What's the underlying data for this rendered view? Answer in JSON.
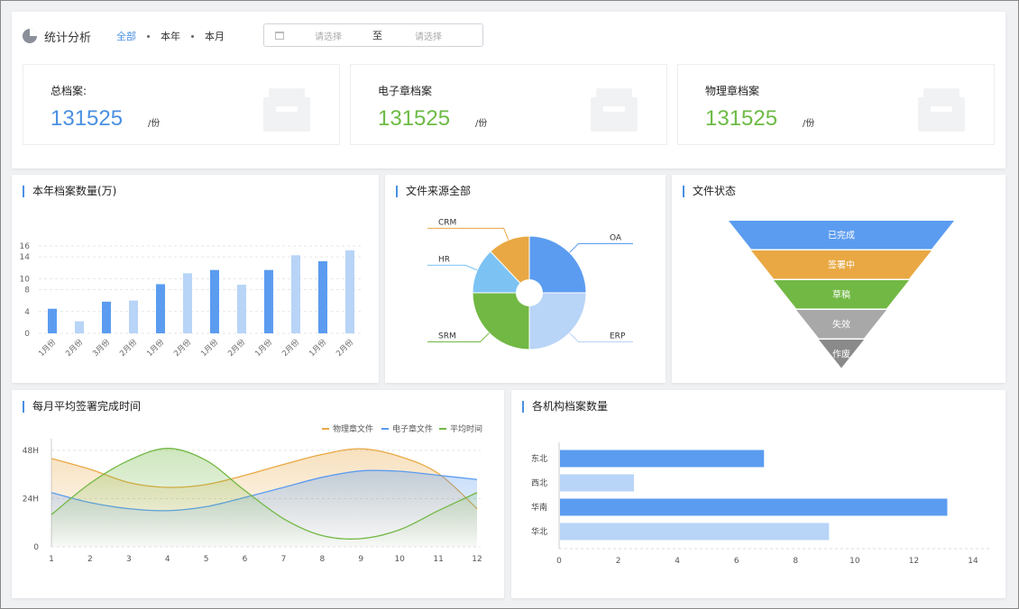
{
  "header": {
    "title": "统计分析",
    "filters": [
      "全部",
      "本年",
      "本月"
    ],
    "active_filter": "全部",
    "date_start_placeholder": "请选择",
    "date_separator": "至",
    "date_end_placeholder": "请选择"
  },
  "stats": [
    {
      "label": "总档案:",
      "value": "131525",
      "unit": "/份",
      "color": "#4a90e2"
    },
    {
      "label": "电子章档案",
      "value": "131525",
      "unit": "/份",
      "color": "#6dbb45"
    },
    {
      "label": "物理章档案",
      "value": "131525",
      "unit": "/份",
      "color": "#6dbb45"
    }
  ],
  "colors": {
    "blue": "#5b9cf0",
    "light_blue": "#b8d4f7",
    "orange": "#e9a843",
    "green": "#72b844",
    "sky": "#7cc3f4",
    "gray": "#a8a8a8",
    "dark_gray": "#8a8a8a"
  },
  "chart_data": [
    {
      "id": "bar",
      "type": "bar",
      "title": "本年档案数量(万)",
      "categories": [
        "1月份",
        "2月份",
        "3月份",
        "2月份",
        "1月份",
        "2月份",
        "1月份",
        "2月份",
        "1月份",
        "2月份",
        "1月份",
        "2月份"
      ],
      "values": [
        4.5,
        2.2,
        5.8,
        6,
        9,
        11,
        11.6,
        8.9,
        11.6,
        14.3,
        13.2,
        15.2
      ],
      "ylim": [
        0,
        16
      ],
      "yticks": [
        "0",
        "4",
        "8",
        "10",
        "14",
        "16"
      ],
      "grid": true
    },
    {
      "id": "pie",
      "type": "pie",
      "title": "文件来源全部",
      "labels": [
        "OA",
        "ERP",
        "SRM",
        "HR",
        "CRM"
      ],
      "values": [
        25,
        25,
        25,
        13,
        12
      ]
    },
    {
      "id": "funnel",
      "type": "funnel",
      "title": "文件状态",
      "labels": [
        "已完成",
        "签署中",
        "草稿",
        "失效",
        "作废"
      ],
      "values": [
        100,
        80,
        60,
        40,
        20
      ]
    },
    {
      "id": "line",
      "type": "area",
      "title": "每月平均签署完成时间",
      "x": [
        1,
        2,
        3,
        4,
        5,
        6,
        7,
        8,
        9,
        10,
        11,
        12
      ],
      "yticks": [
        "0",
        "24H",
        "48H"
      ],
      "ylim": [
        0,
        52
      ],
      "legend_position": "top-right",
      "series": [
        {
          "name": "物理章文件",
          "values": [
            44,
            38.6,
            32,
            29.6,
            31,
            35.6,
            41,
            46,
            48.8,
            45,
            36.5,
            19
          ]
        },
        {
          "name": "电子章文件",
          "values": [
            27,
            22,
            19,
            18,
            20,
            24.6,
            29.6,
            34.6,
            37.8,
            37.6,
            35.6,
            33.5
          ]
        },
        {
          "name": "平均时间",
          "values": [
            16,
            31.6,
            43,
            49,
            43,
            28,
            14,
            5.6,
            4.1,
            8.5,
            18,
            27
          ]
        }
      ]
    },
    {
      "id": "hbar",
      "type": "bar",
      "title": "各机构档案数量",
      "categories": [
        "东北",
        "西北",
        "华南",
        "华北"
      ],
      "values": [
        6.9,
        2.5,
        13.1,
        9.1
      ],
      "xlim": [
        0,
        14
      ],
      "xticks": [
        "0",
        "2",
        "4",
        "6",
        "8",
        "10",
        "12",
        "14"
      ]
    }
  ]
}
